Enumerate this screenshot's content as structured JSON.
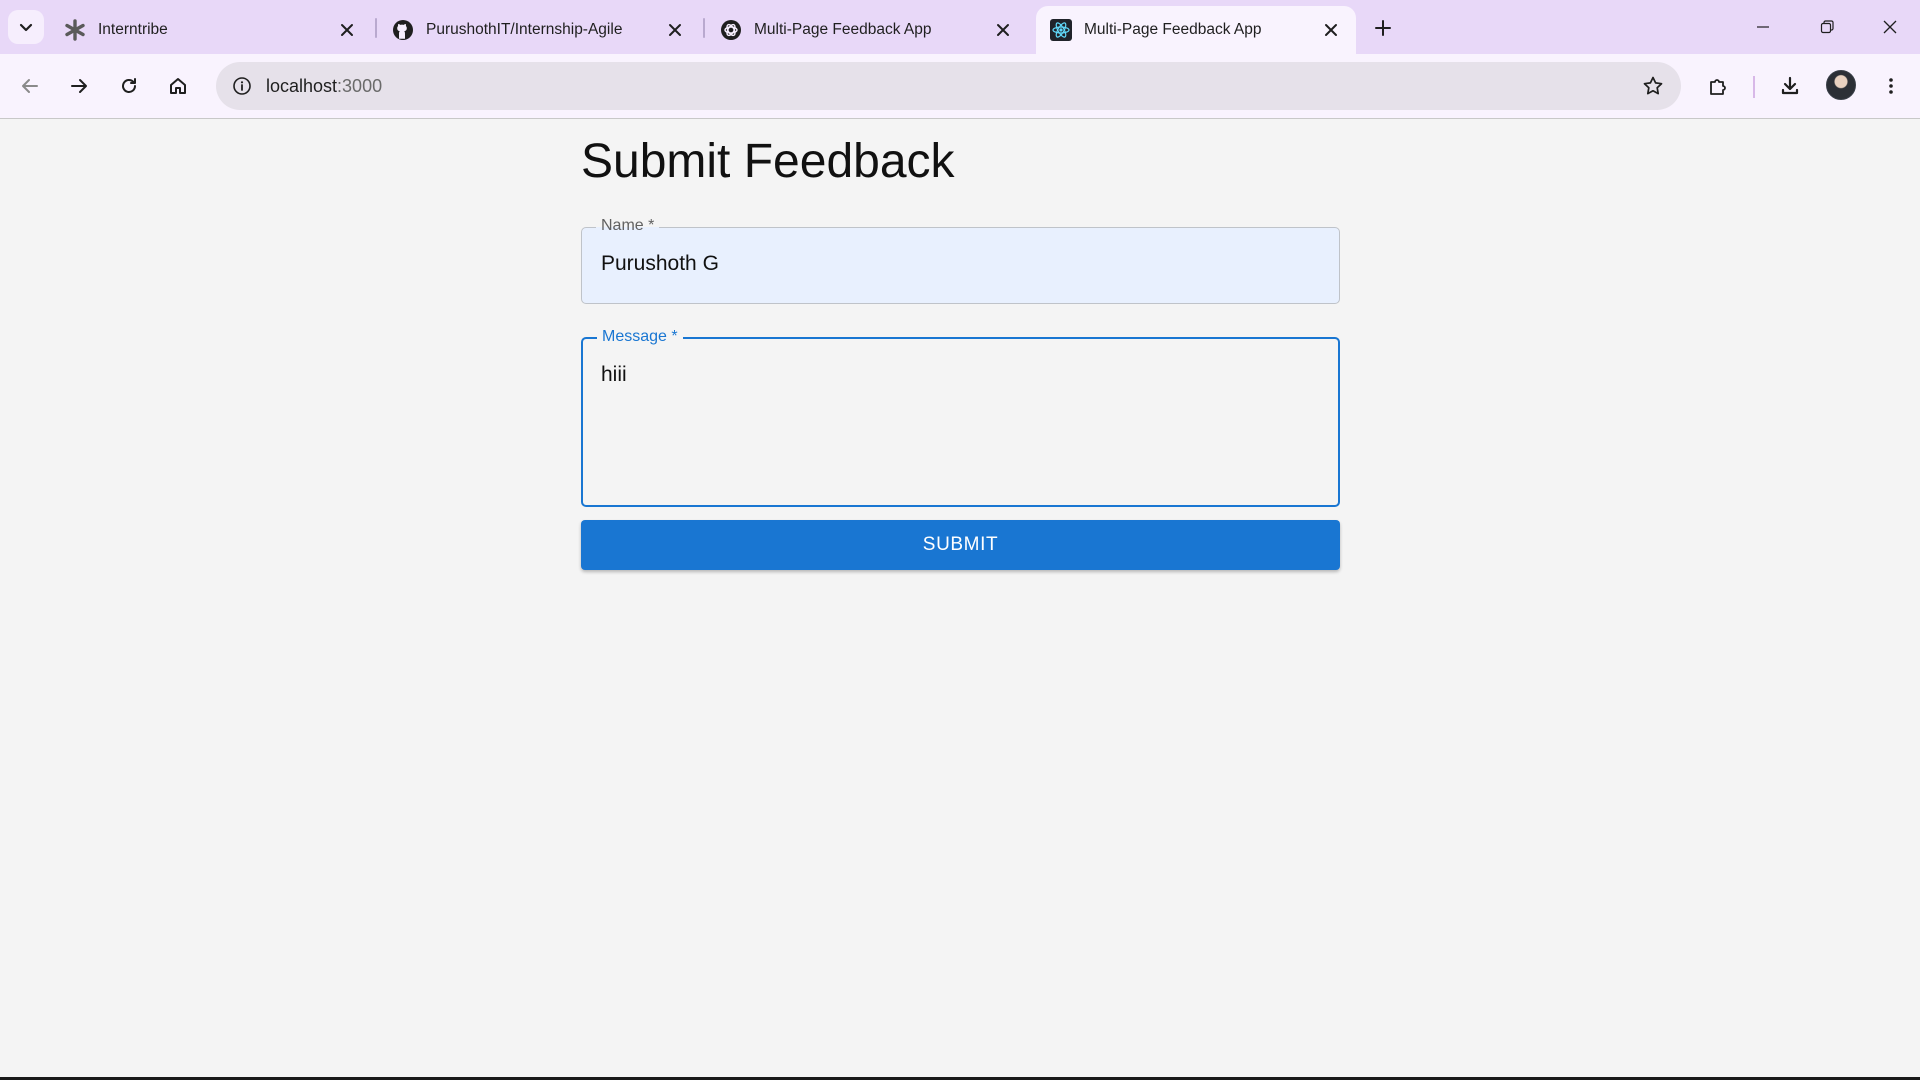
{
  "browser": {
    "tabs": [
      {
        "title": "Interntribe",
        "icon": "interntribe-icon",
        "active": false
      },
      {
        "title": "PurushothIT/Internship-Agile",
        "icon": "github-icon",
        "active": false
      },
      {
        "title": "Multi-Page Feedback App",
        "icon": "openai-icon",
        "active": false
      },
      {
        "title": "Multi-Page Feedback App",
        "icon": "react-icon",
        "active": true
      }
    ],
    "address": {
      "host": "localhost",
      "port": ":3000"
    }
  },
  "page": {
    "title": "Submit Feedback",
    "name_field": {
      "label": "Name *",
      "value": "Purushoth G"
    },
    "message_field": {
      "label": "Message *",
      "value": "hiii"
    },
    "submit_label": "SUBMIT"
  },
  "colors": {
    "accent": "#1976d2",
    "tabstrip": "#e8d8f8",
    "page_bg": "#f4f4f4"
  }
}
